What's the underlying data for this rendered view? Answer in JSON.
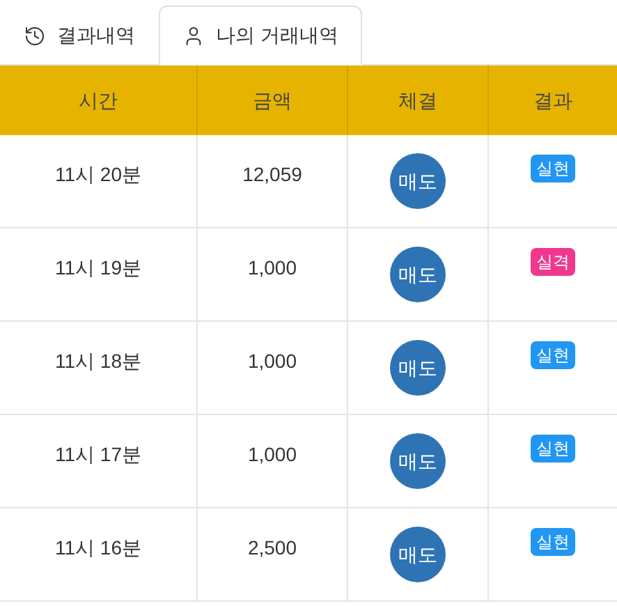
{
  "tabs": [
    {
      "label": "결과내역",
      "kind": "history",
      "selected": false
    },
    {
      "label": "나의 거래내역",
      "kind": "user",
      "selected": true
    }
  ],
  "table": {
    "columns": [
      "시간",
      "금액",
      "체결",
      "결과"
    ],
    "rows": [
      {
        "time": "11시 20분",
        "amount": "12,059",
        "trade": "매도",
        "result": {
          "label": "실현",
          "color": "#2196f3"
        }
      },
      {
        "time": "11시 19분",
        "amount": "1,000",
        "trade": "매도",
        "result": {
          "label": "실격",
          "color": "#f0388f"
        }
      },
      {
        "time": "11시 18분",
        "amount": "1,000",
        "trade": "매도",
        "result": {
          "label": "실현",
          "color": "#2196f3"
        }
      },
      {
        "time": "11시 17분",
        "amount": "1,000",
        "trade": "매도",
        "result": {
          "label": "실현",
          "color": "#2196f3"
        }
      },
      {
        "time": "11시 16분",
        "amount": "2,500",
        "trade": "매도",
        "result": {
          "label": "실현",
          "color": "#2196f3"
        }
      }
    ]
  }
}
